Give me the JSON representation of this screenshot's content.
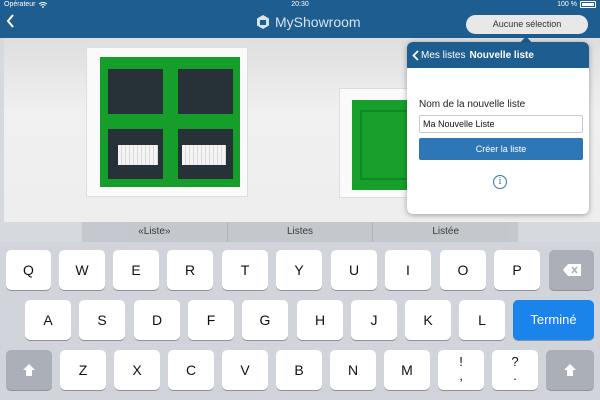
{
  "status_bar": {
    "carrier": "Opérateur",
    "time": "20:30",
    "battery": "100 %"
  },
  "nav": {
    "brand": "MyShowroom",
    "selection_button": "Aucune sélection"
  },
  "popover": {
    "back_label": "Mes listes",
    "title": "Nouvelle liste",
    "field_label": "Nom de la nouvelle liste",
    "input_value": "Ma Nouvelle Liste",
    "create_button": "Créer la liste",
    "info_symbol": "i"
  },
  "suggestions": [
    "«Liste»",
    "Listes",
    "Listée"
  ],
  "keyboard": {
    "row1": [
      "Q",
      "W",
      "E",
      "R",
      "T",
      "Y",
      "U",
      "I",
      "O",
      "P"
    ],
    "row2": [
      "A",
      "S",
      "D",
      "F",
      "G",
      "H",
      "J",
      "K",
      "L"
    ],
    "row3": [
      "Z",
      "X",
      "C",
      "V",
      "B",
      "N",
      "M"
    ],
    "done_label": "Terminé",
    "punct1_top": "!",
    "punct1_bottom": ",",
    "punct2_top": "?",
    "punct2_bottom": "."
  },
  "icons": {
    "back": "chevron-left-icon",
    "wifi": "wifi-icon",
    "battery": "battery-icon",
    "logo": "myshowroom-logo-icon",
    "info": "info-icon",
    "backspace": "backspace-icon",
    "shift": "shift-icon"
  },
  "colors": {
    "brand": "#1e5d8f",
    "accent": "#2e77b7",
    "done_key": "#1a84ea"
  }
}
